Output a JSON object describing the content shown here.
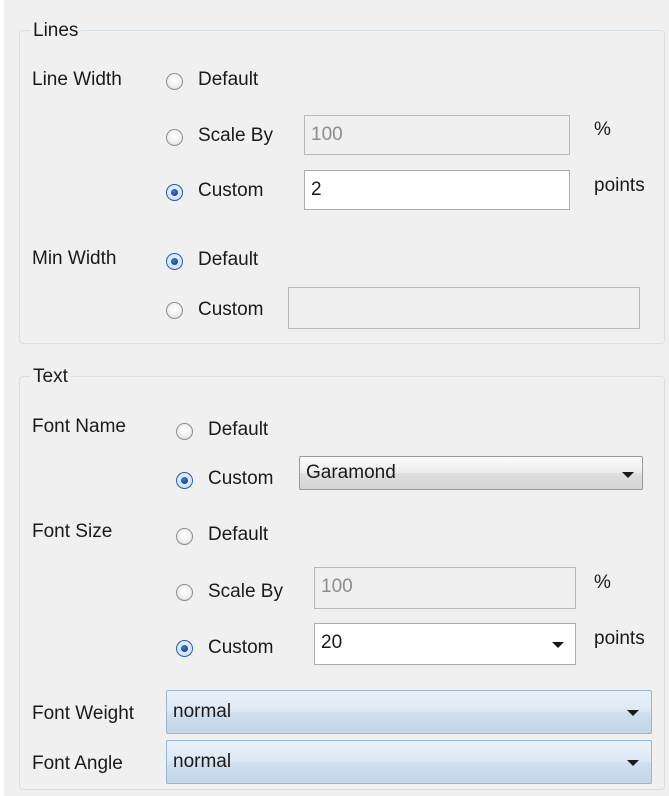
{
  "lines": {
    "title": "Lines",
    "line_width": {
      "label": "Line Width",
      "default_label": "Default",
      "scale_by_label": "Scale By",
      "scale_by_value": "100",
      "scale_by_unit": "%",
      "custom_label": "Custom",
      "custom_value": "2",
      "custom_unit": "points",
      "selected": "Custom"
    },
    "min_width": {
      "label": "Min Width",
      "default_label": "Default",
      "custom_label": "Custom",
      "custom_value": "",
      "selected": "Default"
    }
  },
  "text": {
    "title": "Text",
    "font_name": {
      "label": "Font Name",
      "default_label": "Default",
      "custom_label": "Custom",
      "custom_value": "Garamond",
      "selected": "Custom"
    },
    "font_size": {
      "label": "Font Size",
      "default_label": "Default",
      "scale_by_label": "Scale By",
      "scale_by_value": "100",
      "scale_by_unit": "%",
      "custom_label": "Custom",
      "custom_value": "20",
      "custom_unit": "points",
      "selected": "Custom"
    },
    "font_weight": {
      "label": "Font Weight",
      "value": "normal"
    },
    "font_angle": {
      "label": "Font Angle",
      "value": "normal"
    }
  }
}
